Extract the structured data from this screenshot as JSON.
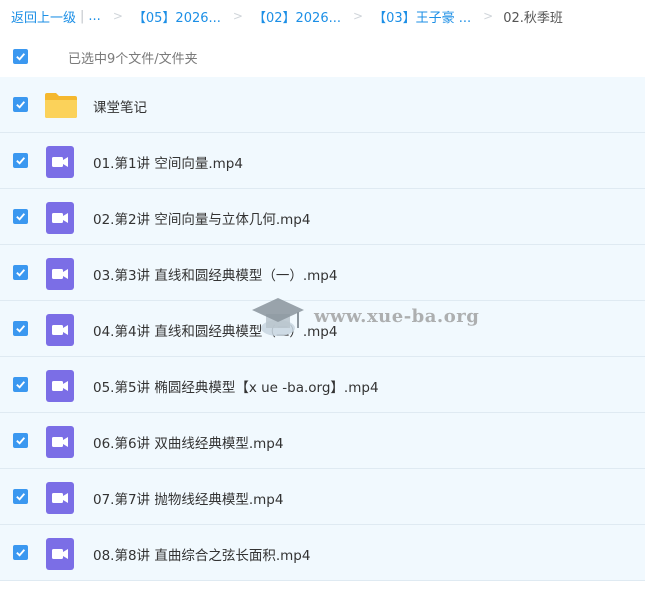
{
  "breadcrumb": {
    "back": "返回上一级",
    "divider": "|",
    "ellipsis": "...",
    "sep": ">",
    "items": [
      "【05】2026...",
      "【02】2026...",
      "【03】王子豪 ..."
    ],
    "current": "02.秋季班"
  },
  "selection": {
    "text": "已选中9个文件/文件夹",
    "checked": true
  },
  "files": [
    {
      "name": "课堂笔记",
      "type": "folder",
      "checked": true
    },
    {
      "name": "01.第1讲 空间向量.mp4",
      "type": "video",
      "checked": true
    },
    {
      "name": "02.第2讲 空间向量与立体几何.mp4",
      "type": "video",
      "checked": true
    },
    {
      "name": "03.第3讲 直线和圆经典模型（一）.mp4",
      "type": "video",
      "checked": true
    },
    {
      "name": "04.第4讲 直线和圆经典模型（二）.mp4",
      "type": "video",
      "checked": true
    },
    {
      "name": "05.第5讲 椭圆经典模型【x ue -ba.org】.mp4",
      "type": "video",
      "checked": true
    },
    {
      "name": "06.第6讲 双曲线经典模型.mp4",
      "type": "video",
      "checked": true
    },
    {
      "name": "07.第7讲 抛物线经典模型.mp4",
      "type": "video",
      "checked": true
    },
    {
      "name": "08.第8讲 直曲综合之弦长面积.mp4",
      "type": "video",
      "checked": true
    }
  ],
  "watermark": {
    "text": "www.xue-ba.org"
  },
  "colors": {
    "link": "#1c8fe6",
    "checkbox": "#3b98f0",
    "row_bg": "#f1f9fe",
    "video_icon": "#7b6ee6",
    "folder_icon": "#f7c948"
  }
}
